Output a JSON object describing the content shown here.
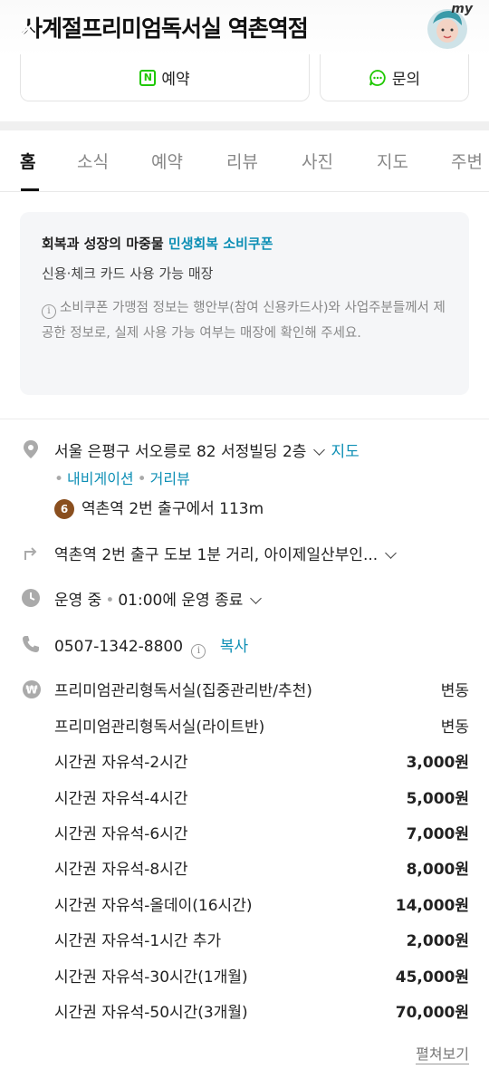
{
  "header": {
    "title": "사계절프리미엄독서실 역촌역점",
    "avatar_tag": "my"
  },
  "actions": {
    "reserve_label": "예약",
    "inquiry_label": "문의"
  },
  "tabs": [
    {
      "label": "홈",
      "active": true
    },
    {
      "label": "소식"
    },
    {
      "label": "예약"
    },
    {
      "label": "리뷰"
    },
    {
      "label": "사진"
    },
    {
      "label": "지도"
    },
    {
      "label": "주변"
    }
  ],
  "coupon": {
    "lead": "회복과 성장의 마중물",
    "highlight": "민생회복 소비쿠폰",
    "line2": "신용·체크 카드 사용 가능 매장",
    "note": "소비쿠폰 가맹점 정보는 행안부(참여 신용카드사)와 사업주분들께서 제공한 정보로, 실제 사용 가능 여부는 매장에 확인해 주세요."
  },
  "address": {
    "text": "서울 은평구 서오릉로 82 서정빌딩 2층",
    "map_link": "지도",
    "navigation": "내비게이션",
    "street_view": "거리뷰",
    "subway_line": "6",
    "subway_text": "역촌역 2번 출구에서 113m"
  },
  "directions": {
    "text": "역촌역 2번 출구 도보 1분 거리, 아이제일산부인..."
  },
  "hours": {
    "status": "운영 중",
    "detail": "01:00에 운영 종료"
  },
  "phone": {
    "number": "0507-1342-8800",
    "copy_label": "복사"
  },
  "prices": [
    {
      "name": "프리미엄관리형독서실(집중관리반/추천)",
      "value": "변동",
      "bold": false
    },
    {
      "name": "프리미엄관리형독서실(라이트반)",
      "value": "변동",
      "bold": false
    },
    {
      "name": "시간권 자유석-2시간",
      "value": "3,000원",
      "bold": true
    },
    {
      "name": "시간권 자유석-4시간",
      "value": "5,000원",
      "bold": true
    },
    {
      "name": "시간권 자유석-6시간",
      "value": "7,000원",
      "bold": true
    },
    {
      "name": "시간권 자유석-8시간",
      "value": "8,000원",
      "bold": true
    },
    {
      "name": "시간권 자유석-올데이(16시간)",
      "value": "14,000원",
      "bold": true
    },
    {
      "name": "시간권 자유석-1시간 추가",
      "value": "2,000원",
      "bold": true
    },
    {
      "name": "시간권 자유석-30시간(1개월)",
      "value": "45,000원",
      "bold": true
    },
    {
      "name": "시간권 자유석-50시간(3개월)",
      "value": "70,000원",
      "bold": true
    }
  ],
  "more_label": "펼쳐보기",
  "colors": {
    "link": "#0d8fb5",
    "naver_green": "#1ec800",
    "subway_line6": "#8a4f1f"
  }
}
